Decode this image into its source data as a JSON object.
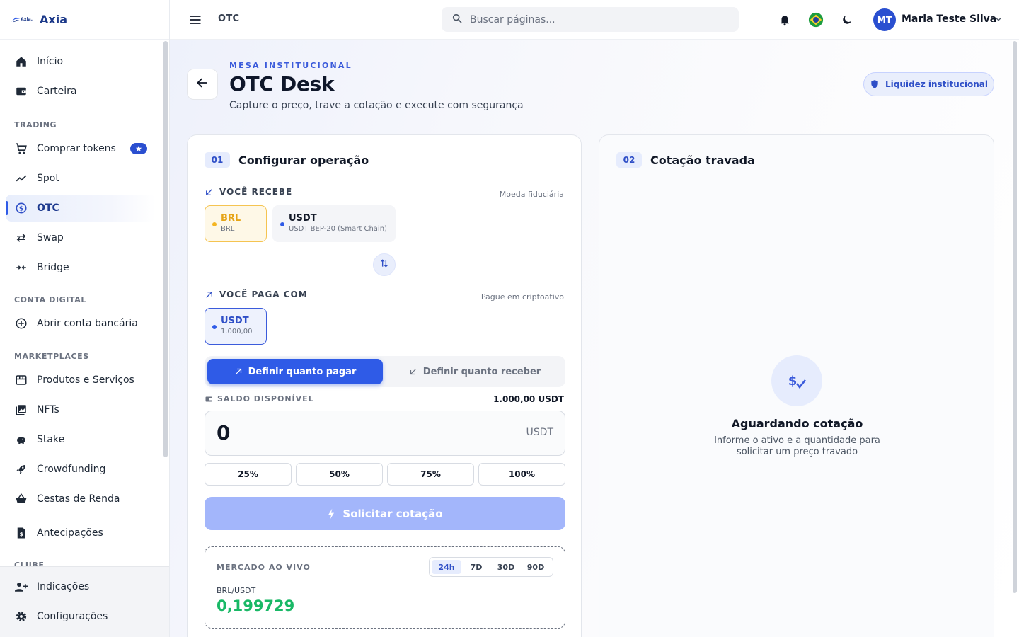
{
  "brand": {
    "logo_text": "Axia.",
    "name": "Axia"
  },
  "sidebar": {
    "items": [
      {
        "label": "Início"
      },
      {
        "label": "Carteira"
      },
      {
        "label": "Comprar tokens"
      },
      {
        "label": "Spot"
      },
      {
        "label": "OTC"
      },
      {
        "label": "Swap"
      },
      {
        "label": "Bridge"
      },
      {
        "label": "Abrir conta bancária"
      },
      {
        "label": "Produtos e Serviços"
      },
      {
        "label": "NFTs"
      },
      {
        "label": "Stake"
      },
      {
        "label": "Crowdfunding"
      },
      {
        "label": "Cestas de Renda"
      },
      {
        "label": "Antecipações"
      }
    ],
    "sections": [
      "TRADING",
      "CONTA DIGITAL",
      "MARKETPLACES",
      "CLUBE"
    ],
    "bottom": [
      {
        "label": "Indicações"
      },
      {
        "label": "Configurações"
      }
    ]
  },
  "topbar": {
    "breadcrumb": "OTC",
    "search_placeholder": "Buscar páginas...",
    "user_initials": "MT",
    "user_name": "Maria Teste Silva"
  },
  "header": {
    "eyebrow": "MESA INSTITUCIONAL",
    "title": "OTC Desk",
    "subtitle": "Capture o preço, trave a cotação e execute com segurança",
    "badge": "Liquidez institucional"
  },
  "config": {
    "step": "01",
    "title": "Configurar operação",
    "receive_label": "VOCÊ RECEBE",
    "receive_hint": "Moeda fiduciária",
    "receive_options": [
      {
        "symbol": "BRL",
        "sub": "BRL"
      },
      {
        "symbol": "USDT",
        "sub": "USDT BEP-20 (Smart Chain)"
      }
    ],
    "pay_label": "VOCÊ PAGA COM",
    "pay_hint": "Pague em criptoativo",
    "pay_option": {
      "symbol": "USDT",
      "sub": "1.000,00"
    },
    "toggle": {
      "pay": "Definir quanto pagar",
      "receive": "Definir quanto receber"
    },
    "balance_label": "SALDO DISPONÍVEL",
    "balance_value": "1.000,00 USDT",
    "amount_value": "0",
    "amount_unit": "USDT",
    "percents": [
      "25%",
      "50%",
      "75%",
      "100%"
    ],
    "cta": "Solicitar cotação",
    "market": {
      "label": "MERCADO AO VIVO",
      "ranges": [
        "24h",
        "7D",
        "30D",
        "90D"
      ],
      "selected_range": "24h",
      "pair": "BRL/USDT",
      "price": "0,199729"
    }
  },
  "quote": {
    "step": "02",
    "title": "Cotação travada",
    "waiting_title": "Aguardando cotação",
    "waiting_sub": "Informe o ativo e a quantidade para solicitar um preço travado"
  },
  "colors": {
    "accent": "#2f5be7",
    "brl": "#f4b521",
    "price_green": "#19b866"
  }
}
